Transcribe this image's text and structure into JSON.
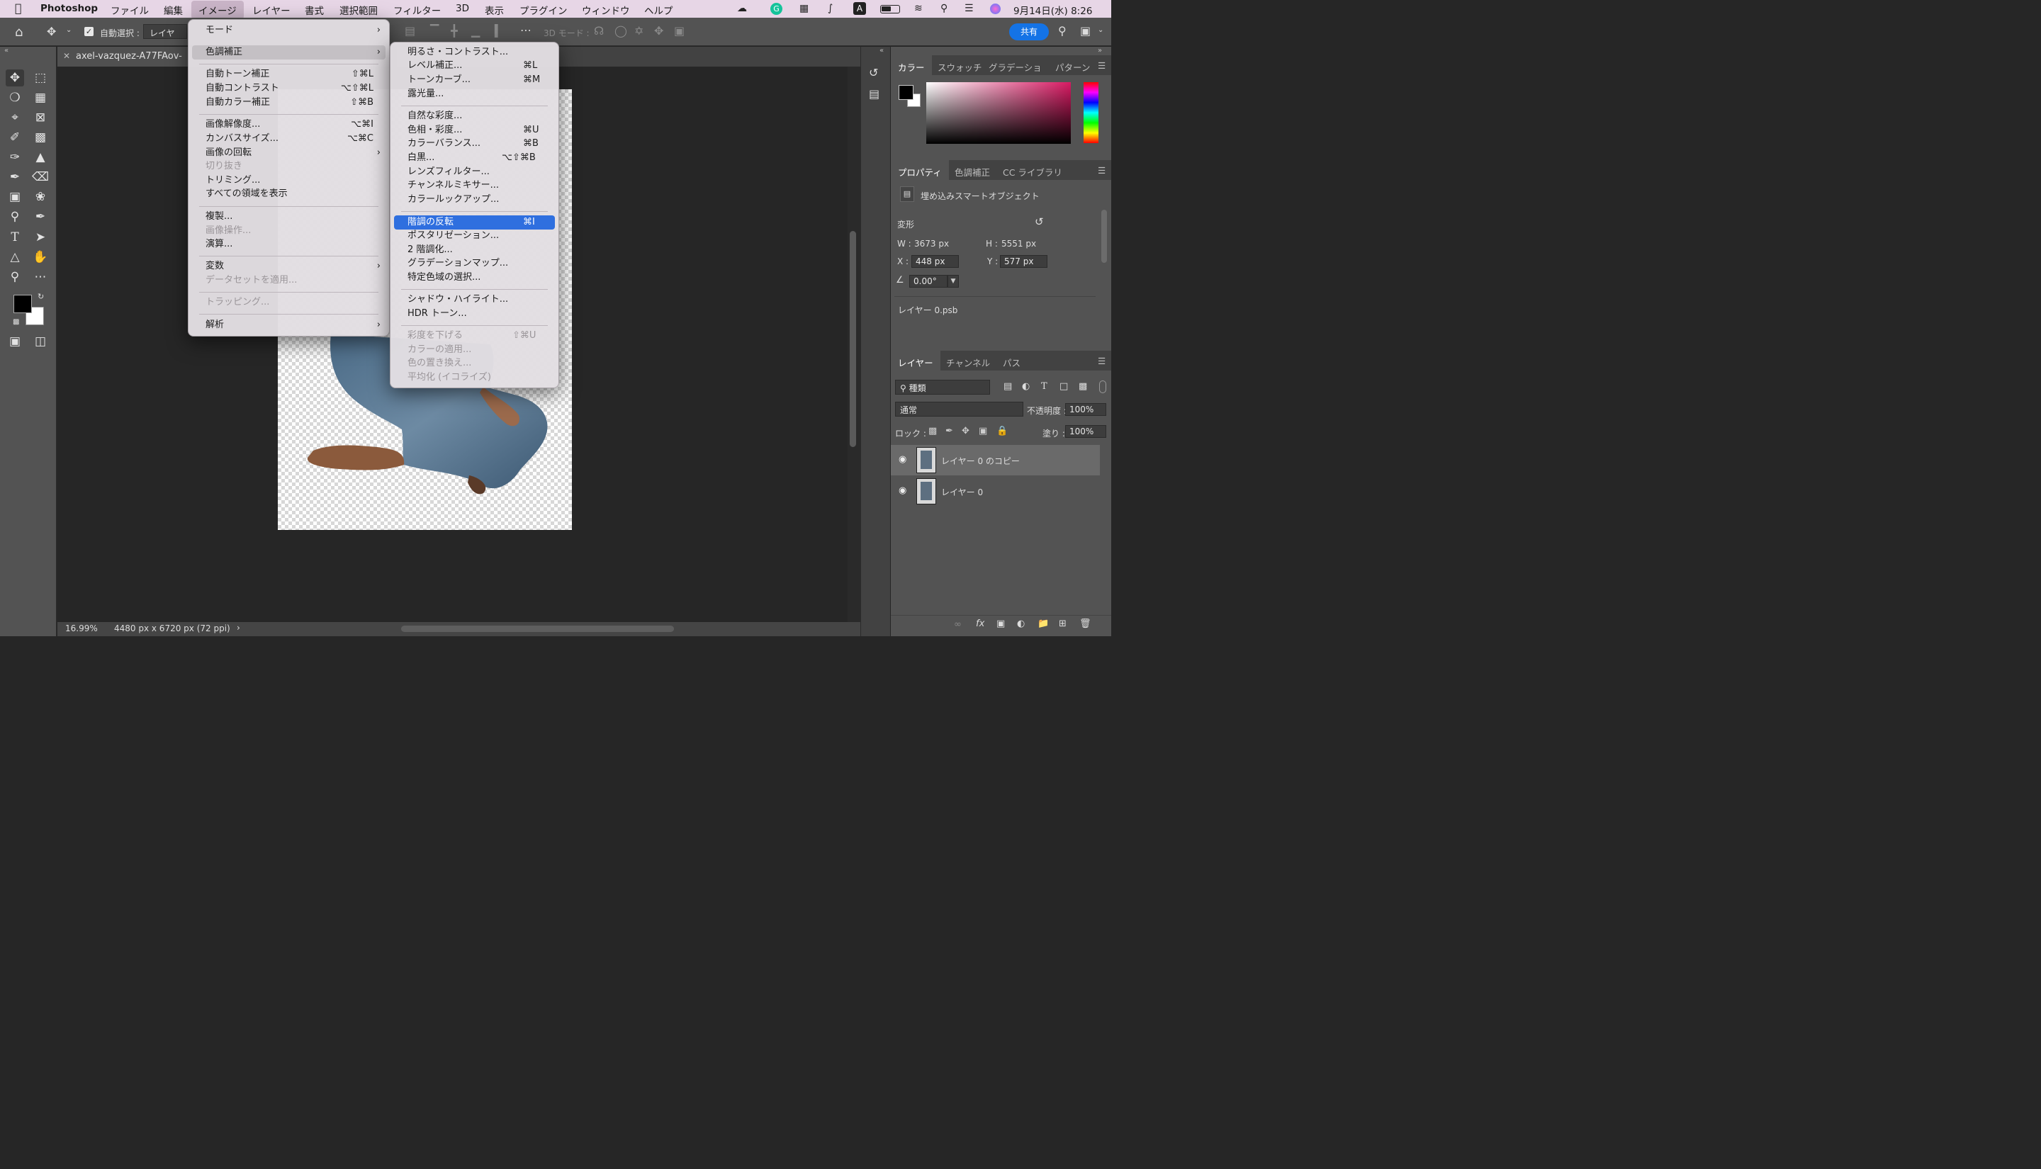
{
  "menubar": {
    "items": [
      "Photoshop",
      "ファイル",
      "編集",
      "イメージ",
      "レイヤー",
      "書式",
      "選択範囲",
      "フィルター",
      "3D",
      "表示",
      "プラグイン",
      "ウィンドウ",
      "ヘルプ"
    ],
    "datetime": "9月14日(水) 8:26",
    "icons": [
      "apple-icon",
      "creative-cloud-icon",
      "grammarly-icon",
      "vpn-icon",
      "bluetooth-icon",
      "input-source-icon",
      "battery-icon",
      "wifi-icon",
      "search-icon",
      "control-center-icon",
      "siri-icon"
    ],
    "input_source": "A"
  },
  "options": {
    "auto_select_label": "自動選択 :",
    "auto_select_value": "レイヤー",
    "mode3d": "3D モード :",
    "share": "共有"
  },
  "document": {
    "tab_title": "axel-vazquez-A77FAov-",
    "zoom": "16.99%",
    "info": "4480 px x 6720 px (72 ppi)"
  },
  "image_menu": {
    "items": [
      {
        "label": "モード",
        "shortcut": "",
        "submenu": true,
        "disabled": false
      },
      {
        "label": "色調補正",
        "shortcut": "",
        "submenu": true,
        "disabled": false
      },
      {
        "label": "自動トーン補正",
        "shortcut": "⇧⌘L",
        "submenu": false,
        "disabled": false
      },
      {
        "label": "自動コントラスト",
        "shortcut": "⌥⇧⌘L",
        "submenu": false,
        "disabled": false
      },
      {
        "label": "自動カラー補正",
        "shortcut": "⇧⌘B",
        "submenu": false,
        "disabled": false
      },
      {
        "label": "画像解像度...",
        "shortcut": "⌥⌘I",
        "submenu": false,
        "disabled": false
      },
      {
        "label": "カンバスサイズ...",
        "shortcut": "⌥⌘C",
        "submenu": false,
        "disabled": false
      },
      {
        "label": "画像の回転",
        "shortcut": "",
        "submenu": true,
        "disabled": false
      },
      {
        "label": "切り抜き",
        "shortcut": "",
        "submenu": false,
        "disabled": true
      },
      {
        "label": "トリミング...",
        "shortcut": "",
        "submenu": false,
        "disabled": false
      },
      {
        "label": "すべての領域を表示",
        "shortcut": "",
        "submenu": false,
        "disabled": false
      },
      {
        "label": "複製...",
        "shortcut": "",
        "submenu": false,
        "disabled": false
      },
      {
        "label": "画像操作...",
        "shortcut": "",
        "submenu": false,
        "disabled": true
      },
      {
        "label": "演算...",
        "shortcut": "",
        "submenu": false,
        "disabled": false
      },
      {
        "label": "変数",
        "shortcut": "",
        "submenu": true,
        "disabled": false
      },
      {
        "label": "データセットを適用...",
        "shortcut": "",
        "submenu": false,
        "disabled": true
      },
      {
        "label": "トラッピング...",
        "shortcut": "",
        "submenu": false,
        "disabled": true
      },
      {
        "label": "解析",
        "shortcut": "",
        "submenu": true,
        "disabled": false
      }
    ]
  },
  "adjust_menu": {
    "items": [
      {
        "label": "明るさ・コントラスト...",
        "shortcut": "",
        "disabled": false
      },
      {
        "label": "レベル補正...",
        "shortcut": "⌘L",
        "disabled": false
      },
      {
        "label": "トーンカーブ...",
        "shortcut": "⌘M",
        "disabled": false
      },
      {
        "label": "露光量...",
        "shortcut": "",
        "disabled": false
      },
      {
        "label": "自然な彩度...",
        "shortcut": "",
        "disabled": false
      },
      {
        "label": "色相・彩度...",
        "shortcut": "⌘U",
        "disabled": false
      },
      {
        "label": "カラーバランス...",
        "shortcut": "⌘B",
        "disabled": false
      },
      {
        "label": "白黒...",
        "shortcut": "⌥⇧⌘B",
        "disabled": false
      },
      {
        "label": "レンズフィルター...",
        "shortcut": "",
        "disabled": false
      },
      {
        "label": "チャンネルミキサー...",
        "shortcut": "",
        "disabled": false
      },
      {
        "label": "カラールックアップ...",
        "shortcut": "",
        "disabled": false
      },
      {
        "label": "階調の反転",
        "shortcut": "⌘I",
        "disabled": false
      },
      {
        "label": "ポスタリゼーション...",
        "shortcut": "",
        "disabled": false
      },
      {
        "label": "2 階調化...",
        "shortcut": "",
        "disabled": false
      },
      {
        "label": "グラデーションマップ...",
        "shortcut": "",
        "disabled": false
      },
      {
        "label": "特定色域の選択...",
        "shortcut": "",
        "disabled": false
      },
      {
        "label": "シャドウ・ハイライト...",
        "shortcut": "",
        "disabled": false
      },
      {
        "label": "HDR トーン...",
        "shortcut": "",
        "disabled": false
      },
      {
        "label": "彩度を下げる",
        "shortcut": "⇧⌘U",
        "disabled": true
      },
      {
        "label": "カラーの適用...",
        "shortcut": "",
        "disabled": true
      },
      {
        "label": "色の置き換え...",
        "shortcut": "",
        "disabled": true
      },
      {
        "label": "平均化 (イコライズ)",
        "shortcut": "",
        "disabled": true
      }
    ]
  },
  "color_panel": {
    "tabs": [
      "カラー",
      "スウォッチ",
      "グラデーショ",
      "パターン"
    ]
  },
  "properties_panel": {
    "tabs": [
      "プロパティ",
      "色調補正",
      "CC ライブラリ"
    ],
    "object_type": "埋め込みスマートオブジェクト",
    "transform_label": "変形",
    "w_label": "W :",
    "w": "3673 px",
    "h_label": "H :",
    "h": "5551 px",
    "x_label": "X :",
    "x": "448 px",
    "y_label": "Y :",
    "y": "577 px",
    "angle": "0.00°",
    "file": "レイヤー 0.psb"
  },
  "layers_panel": {
    "tabs": [
      "レイヤー",
      "チャンネル",
      "パス"
    ],
    "filter": "種類",
    "blend": "通常",
    "opacity_label": "不透明度 :",
    "opacity": "100%",
    "lock_label": "ロック :",
    "fill_label": "塗り :",
    "fill": "100%",
    "layers": [
      "レイヤー 0 のコピー",
      "レイヤー 0"
    ]
  },
  "colors": {
    "menubar": "#e7d6e6",
    "highlight": "#2f6fdf",
    "share": "#1473e6"
  }
}
